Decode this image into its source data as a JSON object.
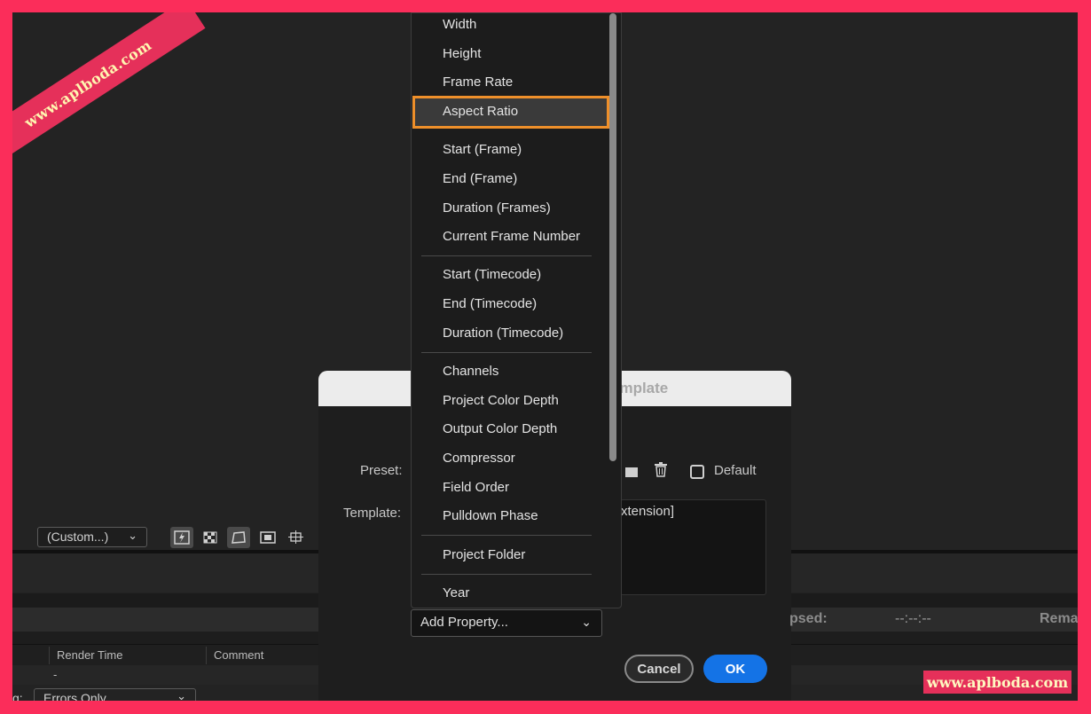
{
  "watermark": {
    "top_left": "www.aplboda.com",
    "bottom_right": "www.aplboda.com"
  },
  "toolbar": {
    "view_select": "(Custom...)",
    "chevron": "⌄"
  },
  "columns": {
    "render_time": "Render Time",
    "comment": "Comment"
  },
  "queue_row": {
    "dash": "-"
  },
  "log": {
    "label_fragment": "g:",
    "value": "Errors Only"
  },
  "dialog": {
    "title_fragment": "emplate",
    "preset_label": "Preset:",
    "template_label": "Template:",
    "default_label": "Default",
    "template_value": "xtension]",
    "cancel_label": "Cancel",
    "ok_label": "OK"
  },
  "status": {
    "elapsed": "psed:",
    "time": "--:--:--",
    "remaining": "Rema"
  },
  "menu": {
    "groups": [
      [
        "Width",
        "Height",
        "Frame Rate",
        "Aspect Ratio"
      ],
      [
        "Start (Frame)",
        "End (Frame)",
        "Duration (Frames)",
        "Current Frame Number"
      ],
      [
        "Start (Timecode)",
        "End (Timecode)",
        "Duration (Timecode)"
      ],
      [
        "Channels",
        "Project Color Depth",
        "Output Color Depth",
        "Compressor",
        "Field Order",
        "Pulldown Phase"
      ],
      [
        "Project Folder"
      ],
      [
        "Year"
      ]
    ],
    "highlighted": "Aspect Ratio",
    "highlight_color": "#ee8f2a"
  },
  "add_property": {
    "label": "Add Property..."
  }
}
